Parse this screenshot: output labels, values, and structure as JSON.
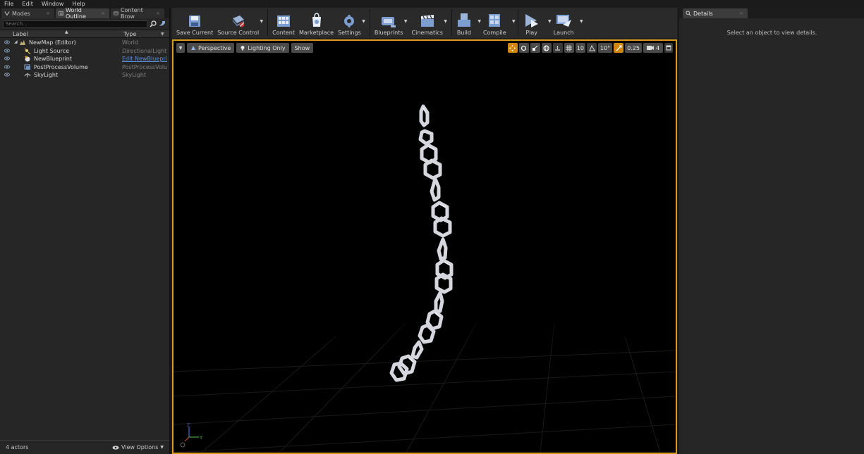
{
  "menu": [
    "File",
    "Edit",
    "Window",
    "Help"
  ],
  "left_tabs": [
    {
      "label": "Modes",
      "icon": "modes-icon"
    },
    {
      "label": "World Outline",
      "icon": "world-outliner-icon"
    },
    {
      "label": "Content Brow",
      "icon": "content-browser-icon"
    }
  ],
  "outliner": {
    "search_placeholder": "Search...",
    "col_label": "Label",
    "col_type": "Type",
    "rows": [
      {
        "label": "NewMap (Editor)",
        "type": "World",
        "icon": "world-icon",
        "link": false
      },
      {
        "label": "Light Source",
        "type": "DirectionalLight",
        "icon": "directional-light-icon",
        "link": false
      },
      {
        "label": "NewBlueprint",
        "type": "Edit NewBlueprin",
        "icon": "blueprint-actor-icon",
        "link": true
      },
      {
        "label": "PostProcessVolume",
        "type": "PostProcessVolun",
        "icon": "post-process-volume-icon",
        "link": false
      },
      {
        "label": "SkyLight",
        "type": "SkyLight",
        "icon": "sky-light-icon",
        "link": false
      }
    ],
    "actor_count": "4 actors",
    "view_options": "View Options"
  },
  "toolbar": [
    {
      "label": "Save Current",
      "icon": "save-icon",
      "dropdown": false
    },
    {
      "label": "Source Control",
      "icon": "source-control-icon",
      "dropdown": true
    },
    {
      "label": "Content",
      "icon": "content-icon",
      "dropdown": false
    },
    {
      "label": "Marketplace",
      "icon": "marketplace-icon",
      "dropdown": false
    },
    {
      "label": "Settings",
      "icon": "settings-icon",
      "dropdown": true
    },
    {
      "label": "Blueprints",
      "icon": "blueprints-icon",
      "dropdown": true
    },
    {
      "label": "Cinematics",
      "icon": "cinematics-icon",
      "dropdown": true
    },
    {
      "label": "Build",
      "icon": "build-icon",
      "dropdown": true
    },
    {
      "label": "Compile",
      "icon": "compile-icon",
      "dropdown": true
    },
    {
      "label": "Play",
      "icon": "play-icon",
      "dropdown": true
    },
    {
      "label": "Launch",
      "icon": "launch-icon",
      "dropdown": true
    }
  ],
  "viewport": {
    "perspective": "Perspective",
    "lighting": "Lighting Only",
    "show": "Show",
    "grid_snap": "10",
    "rotation_snap": "10°",
    "scale_snap": "0.25",
    "camera_speed": "4",
    "axis_y": "Y",
    "axis_z": "Z"
  },
  "details": {
    "tab": "Details",
    "empty": "Select an object to view details."
  },
  "colors": {
    "viewport_border": "#d99a1e",
    "accent_orange": "#d08612",
    "link_blue": "#5a8fd8"
  }
}
